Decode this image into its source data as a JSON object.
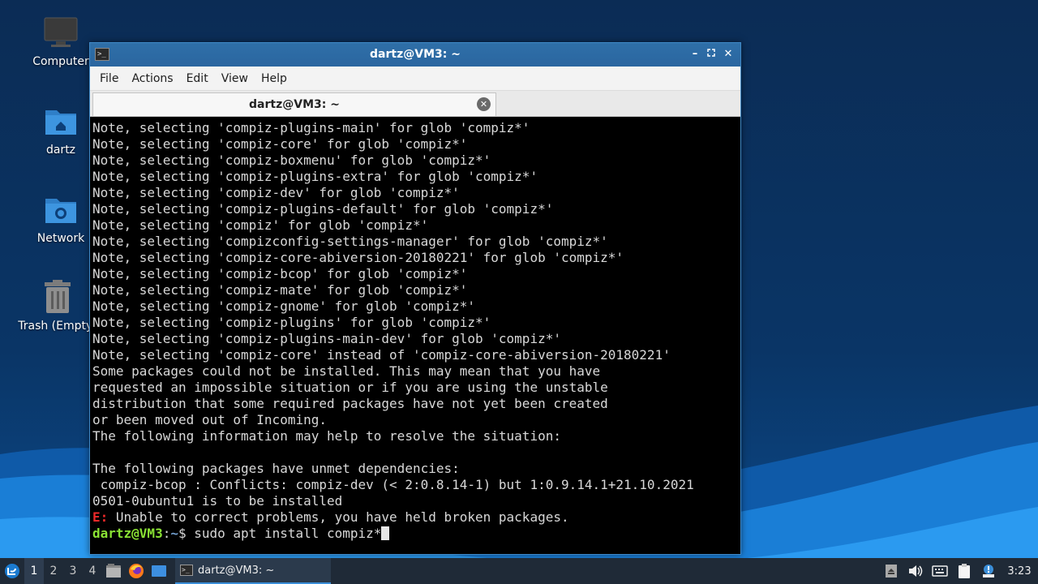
{
  "desktop": {
    "icons": [
      {
        "label": "Computer"
      },
      {
        "label": "dartz"
      },
      {
        "label": "Network"
      },
      {
        "label": "Trash (Empty)"
      }
    ]
  },
  "window": {
    "title": "dartz@VM3: ~",
    "menu": [
      "File",
      "Actions",
      "Edit",
      "View",
      "Help"
    ],
    "tab_title": "dartz@VM3: ~"
  },
  "terminal": {
    "lines": [
      "Note, selecting 'compiz-plugins-main' for glob 'compiz*'",
      "Note, selecting 'compiz-core' for glob 'compiz*'",
      "Note, selecting 'compiz-boxmenu' for glob 'compiz*'",
      "Note, selecting 'compiz-plugins-extra' for glob 'compiz*'",
      "Note, selecting 'compiz-dev' for glob 'compiz*'",
      "Note, selecting 'compiz-plugins-default' for glob 'compiz*'",
      "Note, selecting 'compiz' for glob 'compiz*'",
      "Note, selecting 'compizconfig-settings-manager' for glob 'compiz*'",
      "Note, selecting 'compiz-core-abiversion-20180221' for glob 'compiz*'",
      "Note, selecting 'compiz-bcop' for glob 'compiz*'",
      "Note, selecting 'compiz-mate' for glob 'compiz*'",
      "Note, selecting 'compiz-gnome' for glob 'compiz*'",
      "Note, selecting 'compiz-plugins' for glob 'compiz*'",
      "Note, selecting 'compiz-plugins-main-dev' for glob 'compiz*'",
      "Note, selecting 'compiz-core' instead of 'compiz-core-abiversion-20180221'",
      "Some packages could not be installed. This may mean that you have",
      "requested an impossible situation or if you are using the unstable",
      "distribution that some required packages have not yet been created",
      "or been moved out of Incoming.",
      "The following information may help to resolve the situation:",
      "",
      "The following packages have unmet dependencies:",
      " compiz-bcop : Conflicts: compiz-dev (< 2:0.8.14-1) but 1:0.9.14.1+21.10.2021",
      "0501-0ubuntu1 is to be installed"
    ],
    "error_prefix": "E:",
    "error_text": " Unable to correct problems, you have held broken packages.",
    "prompt_user": "dartz@VM3",
    "prompt_sep": ":",
    "prompt_path": "~",
    "prompt_symbol": "$ ",
    "command": "sudo apt install compiz*"
  },
  "taskbar": {
    "workspaces": [
      "1",
      "2",
      "3",
      "4"
    ],
    "active_workspace": "1",
    "task_label": "dartz@VM3: ~",
    "clock": "3:23"
  },
  "colors": {
    "title_bar": "#2f6fa8",
    "error": "#ef2929",
    "prompt_user": "#8ae234",
    "prompt_path": "#729fcf",
    "taskbar": "#1f2a37"
  }
}
